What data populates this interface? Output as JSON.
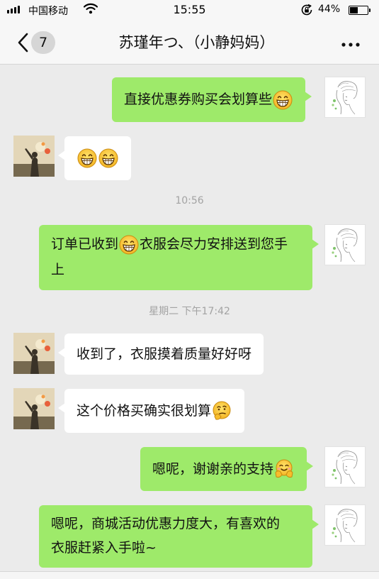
{
  "status_bar": {
    "carrier": "中国移动",
    "time": "15:55",
    "battery": "44%",
    "battery_level": 0.44
  },
  "nav": {
    "unread_count": "7",
    "title": "苏瑾年つ、（小静妈妈）"
  },
  "messages": [
    {
      "side": "right",
      "text_before": "直接优惠券购买会划算些",
      "emoji": "grin"
    },
    {
      "side": "left",
      "emojis": [
        "grin",
        "grin"
      ]
    },
    {
      "side": "right",
      "line1_before": "订单已收到",
      "emoji": "grin",
      "line1_after": "衣服会尽力安排送到您手",
      "line2": "上"
    },
    {
      "side": "left",
      "text": "收到了，衣服摸着质量好好呀"
    },
    {
      "side": "left",
      "text_before": "这个价格买确实很划算",
      "emoji": "thinking"
    },
    {
      "side": "right",
      "text_before": "嗯呢，谢谢亲的支持",
      "emoji": "hug"
    },
    {
      "side": "right",
      "line1": "嗯呢，商城活动优惠力度大，有喜欢的",
      "line2": "衣服赶紧入手啦~"
    }
  ],
  "timestamps": [
    "10:56",
    "星期二 下午17:42"
  ],
  "colors": {
    "background": "#ebebeb",
    "outgoing_bubble": "#9eea6a",
    "incoming_bubble": "#ffffff",
    "timestamp_text": "#a3a3a3"
  },
  "icons": [
    "signal-icon",
    "wifi-icon",
    "lock-rotation-icon",
    "battery-icon",
    "back-chevron-icon",
    "more-dots-icon",
    "grin-emoji-icon",
    "thinking-emoji-icon",
    "hug-emoji-icon"
  ]
}
